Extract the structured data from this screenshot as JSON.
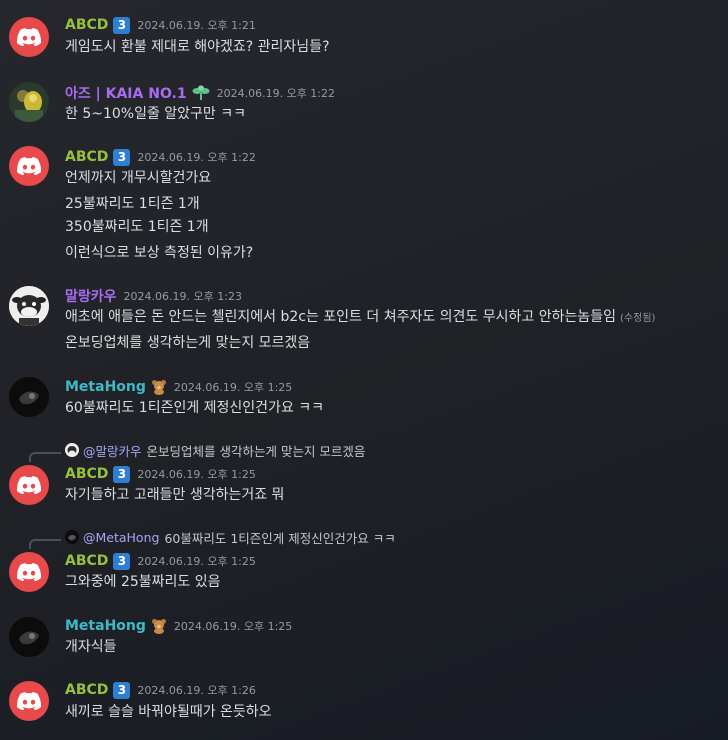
{
  "messages": [
    {
      "author": "ABCD",
      "badge": "3",
      "time": "2024.06.19. 오후 1:21",
      "lines": [
        "게임도시 환불 제대로 해야겠죠? 관리자님들?"
      ]
    },
    {
      "author": "아즈 | KAIA NO.1",
      "time": "2024.06.19. 오후 1:22",
      "lines": [
        "한 5~10%일줄 알았구만 ㅋㅋ"
      ]
    },
    {
      "author": "ABCD",
      "badge": "3",
      "time": "2024.06.19. 오후 1:22",
      "lines": [
        "언제까지 개무시할건가요",
        "25불짜리도 1티즌 1개",
        "350불짜리도 1티즌 1개",
        "이런식으로 보상 측정된 이유가?"
      ]
    },
    {
      "author": "말랑카우",
      "time": "2024.06.19. 오후 1:23",
      "lines": [
        "애초에 애들은 돈 안드는 첼린지에서 b2c는 포인트 더 쳐주자도 의견도 무시하고 안하는놈들임",
        "온보딩업체를 생각하는게 맞는지 모르겠음"
      ],
      "edited": "(수정됨)"
    },
    {
      "author": "MetaHong",
      "time": "2024.06.19. 오후 1:25",
      "lines": [
        "60불짜리도 1티즌인게 제정신인건가요 ㅋㅋ"
      ]
    },
    {
      "reply": {
        "name": "@말랑카우",
        "text": "온보딩업체를 생각하는게 맞는지 모르겠음"
      },
      "author": "ABCD",
      "badge": "3",
      "time": "2024.06.19. 오후 1:25",
      "lines": [
        "자기들하고 고래들만 생각하는거죠 뭐"
      ]
    },
    {
      "reply": {
        "name": "@MetaHong",
        "text": "60불짜리도 1티즌인게 제정신인건가요 ㅋㅋ"
      },
      "author": "ABCD",
      "badge": "3",
      "time": "2024.06.19. 오후 1:25",
      "lines": [
        "그와중에 25불짜리도 있음"
      ]
    },
    {
      "author": "MetaHong",
      "time": "2024.06.19. 오후 1:25",
      "lines": [
        "개자식들"
      ]
    },
    {
      "author": "ABCD",
      "badge": "3",
      "time": "2024.06.19. 오후 1:26",
      "lines": [
        "새끼로 슬슬 바꿔야될때가 온듯하오"
      ]
    }
  ],
  "colors": {
    "background": "#1f2126",
    "text": "#dbdee1",
    "muted": "#949ba4",
    "abcd": "#95c13d",
    "azu": "#a76cf0",
    "malang": "#a76cf0",
    "metahong": "#3fb9c8",
    "discord_red": "#e8494b",
    "badge_blue": "#2e7fd3",
    "mention": "#a4a6f5"
  },
  "icons": {
    "discord_avatar": "discord-logo-icon",
    "badge": "number-3-badge-icon",
    "azu_badge": "green-sprout-icon",
    "metahong_badge": "teddy-bear-icon",
    "reply": "reply-spine-icon"
  }
}
